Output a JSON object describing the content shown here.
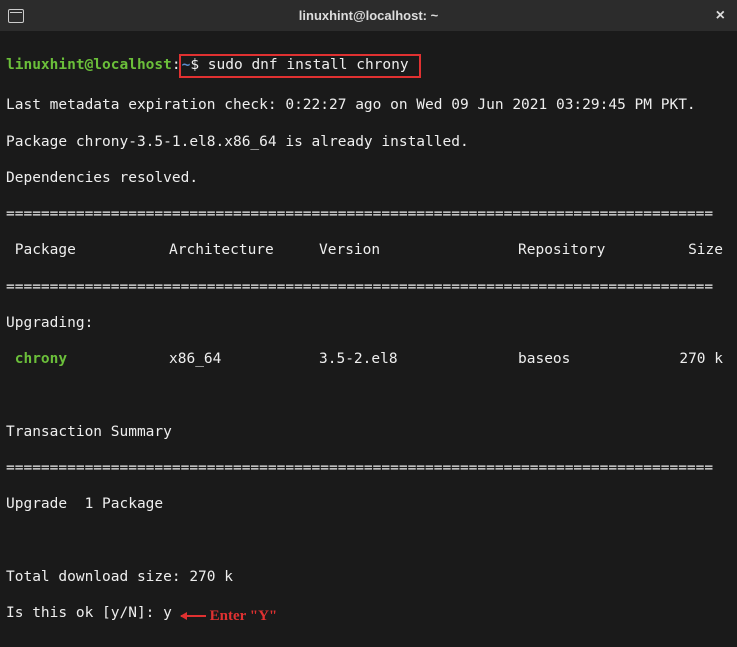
{
  "titlebar": {
    "title": "linuxhint@localhost: ~",
    "close": "×"
  },
  "prompt": {
    "user_host": "linuxhint@localhost",
    "colon": ":",
    "cwd": "~",
    "dollar": "$",
    "command": " sudo dnf install chrony "
  },
  "lines": {
    "metadata": "Last metadata expiration check: 0:22:27 ago on Wed 09 Jun 2021 03:29:45 PM PKT.",
    "already": "Package chrony-3.5-1.el8.x86_64 is already installed.",
    "deps": "Dependencies resolved.",
    "rule": "=================================================================================",
    "hdr_pkg": " Package",
    "hdr_arch": "Architecture",
    "hdr_ver": "Version",
    "hdr_repo": "Repository",
    "hdr_size": "Size",
    "upgrading": "Upgrading:",
    "row_name": " chrony",
    "row_arch": "x86_64",
    "row_ver": "3.5-2.el8",
    "row_repo": "baseos",
    "row_size": "270 k",
    "txn": "Transaction Summary",
    "upgrade_count": "Upgrade  1 Package",
    "dl": "Total download size: 270 k",
    "confirm": "Is this ok [y/N]: y ",
    "annot": "Enter \"Y\""
  }
}
